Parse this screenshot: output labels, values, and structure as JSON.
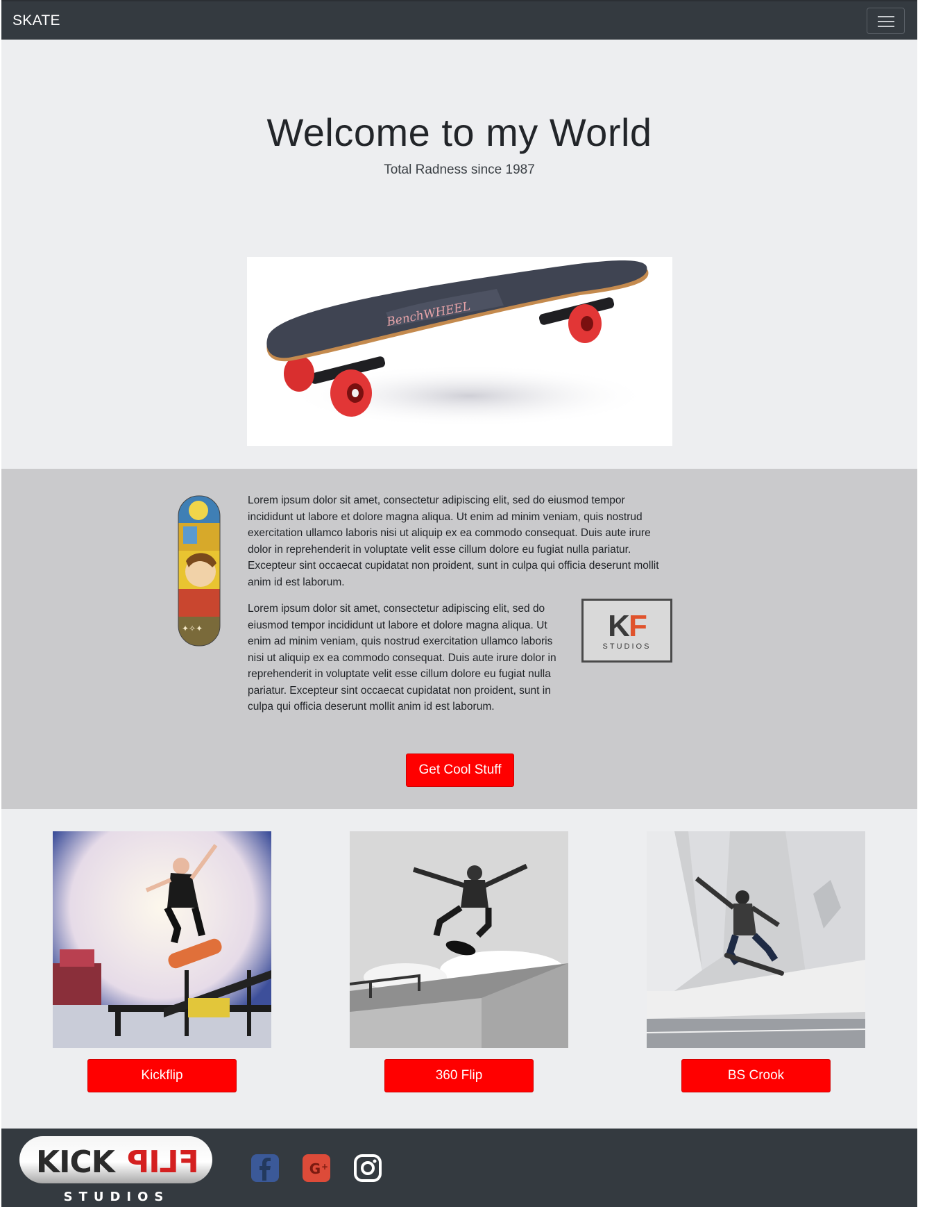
{
  "navbar": {
    "brand": "SKATE",
    "menu_icon": "hamburger-menu-icon"
  },
  "hero": {
    "title": "Welcome to my World",
    "subtitle": "Total Radness since 1987",
    "image": "longboard-product-image",
    "board_brand_text": "BenchWHEEL"
  },
  "about": {
    "deck_image": "graffiti-skateboard-deck-image",
    "paragraph1": "Lorem ipsum dolor sit amet, consectetur adipiscing elit, sed do eiusmod tempor incididunt ut labore et dolore magna aliqua. Ut enim ad minim veniam, quis nostrud exercitation ullamco laboris nisi ut aliquip ex ea commodo consequat. Duis aute irure dolor in reprehenderit in voluptate velit esse cillum dolore eu fugiat nulla pariatur. Excepteur sint occaecat cupidatat non proident, sunt in culpa qui officia deserunt mollit anim id est laborum.",
    "paragraph2": "Lorem ipsum dolor sit amet, consectetur adipiscing elit, sed do eiusmod tempor incididunt ut labore et dolore magna aliqua. Ut enim ad minim veniam, quis nostrud exercitation ullamco laboris nisi ut aliquip ex ea commodo consequat. Duis aute irure dolor in reprehenderit in voluptate velit esse cillum dolore eu fugiat nulla pariatur. Excepteur sint occaecat cupidatat non proident, sunt in culpa qui officia deserunt mollit anim id est laborum.",
    "kf_logo": {
      "letters_k": "K",
      "letters_f": "F",
      "studios": "STUDIOS",
      "accent_color": "#e0532c"
    },
    "cta_label": "Get Cool Stuff"
  },
  "tricks": [
    {
      "label": "Kickflip",
      "image": "kickflip-photo"
    },
    {
      "label": "360 Flip",
      "image": "360-flip-photo"
    },
    {
      "label": "BS Crook",
      "image": "bs-crook-photo"
    }
  ],
  "footer": {
    "logo_text_kick": "KICK",
    "logo_text_flip": "FLIP",
    "logo_studios": "STUDIOS",
    "social": [
      {
        "icon": "facebook-icon",
        "color": "#3b5998"
      },
      {
        "icon": "google-plus-icon",
        "color": "#dd4b39"
      },
      {
        "icon": "instagram-icon",
        "color": "#ffffff"
      }
    ]
  },
  "colors": {
    "navbar": "#343a40",
    "button": "#ff0000",
    "page_bg": "#edeef0",
    "section_bg": "#cacacc"
  }
}
